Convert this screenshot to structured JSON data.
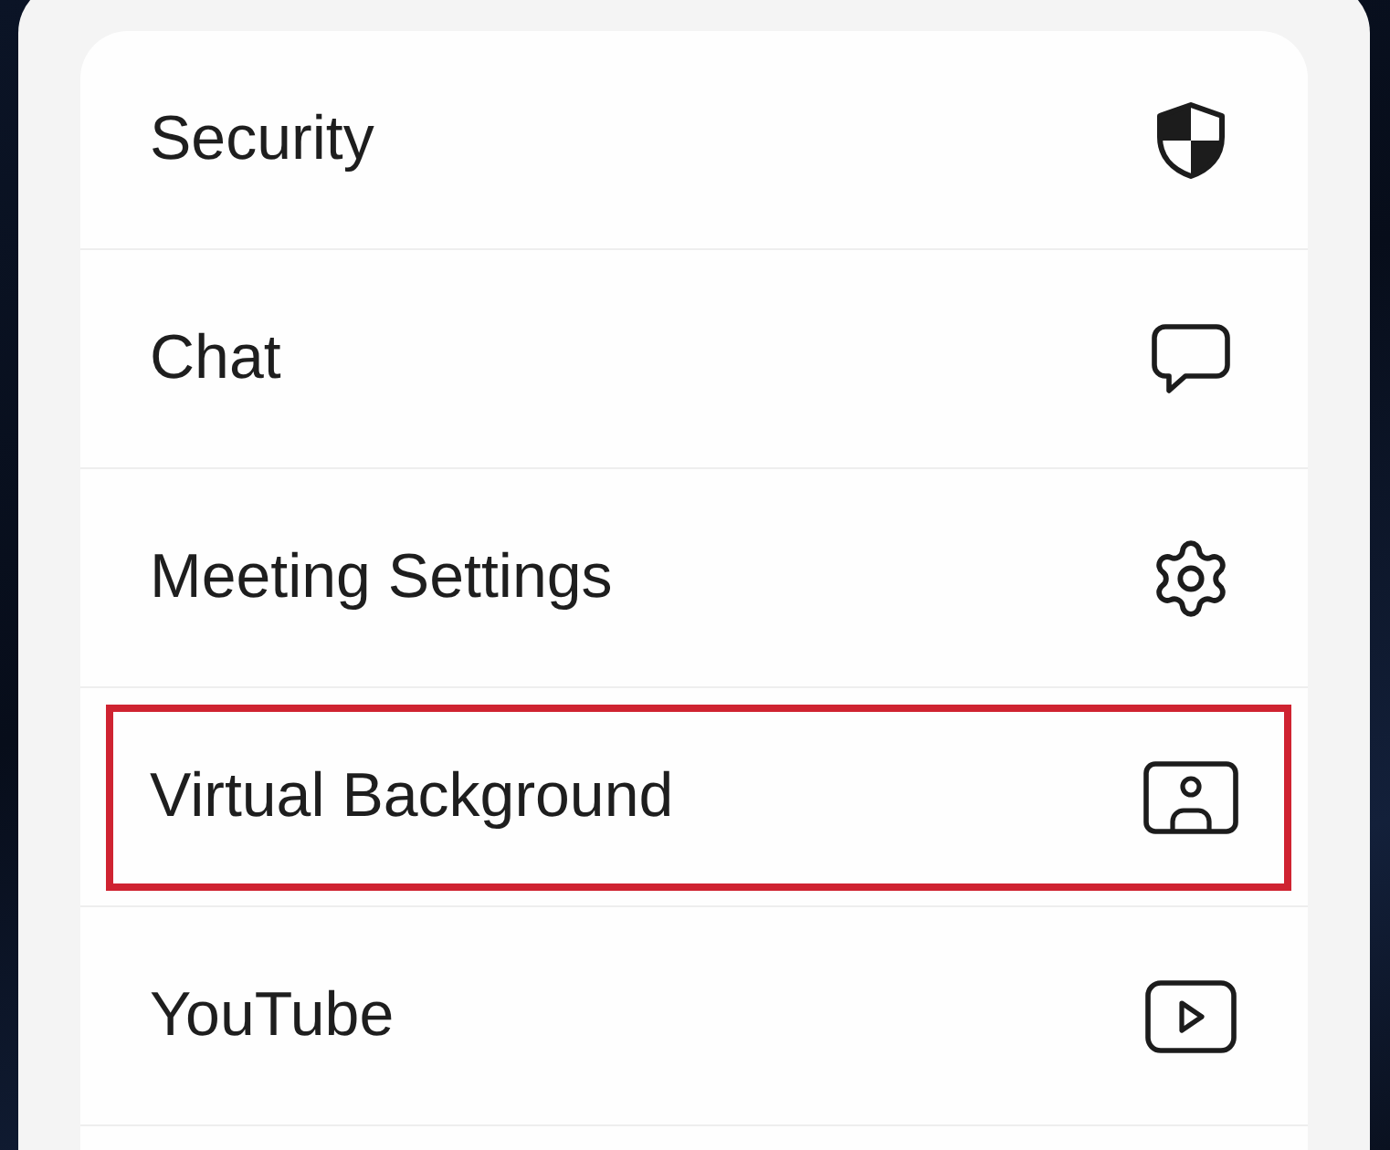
{
  "menu": {
    "items": [
      {
        "kind": "security",
        "label": "Security",
        "highlighted": false
      },
      {
        "kind": "chat",
        "label": "Chat",
        "highlighted": false
      },
      {
        "kind": "settings",
        "label": "Meeting Settings",
        "highlighted": false
      },
      {
        "kind": "virtual_background",
        "label": "Virtual Background",
        "highlighted": true
      },
      {
        "kind": "youtube",
        "label": "YouTube",
        "highlighted": false
      }
    ]
  }
}
